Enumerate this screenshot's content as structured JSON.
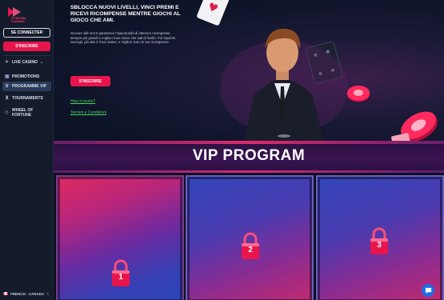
{
  "brand": {
    "logo_text": "STREAM\nCASINO"
  },
  "sidebar": {
    "connect_label": "SE CONNECTER",
    "signup_label": "S'INSCRIRE",
    "items": [
      {
        "label": "LIVE CASINO",
        "icon": "diamond-icon",
        "has_chevron": true
      },
      {
        "label": "PROMOTIONS",
        "icon": "gift-icon"
      },
      {
        "label": "PROGRAMME VIP",
        "icon": "crown-icon",
        "active": true
      },
      {
        "label": "TOURNAMENTS",
        "icon": "trophy-icon"
      },
      {
        "label": "WHEEL OF FORTUNE",
        "icon": "tag-icon"
      }
    ],
    "language": "FRENCH - CANADA"
  },
  "hero": {
    "title": "SBLOCCA NUOVI LIVELLI, VINCI PREMI E RICEVI RICOMPENSE MENTRE GIOCHI AL GIOCO CHE AMI.",
    "description": "Giocare alle slot ti garantisce l'opportunità di ottenere ricompense sempre più grandi e migliori man mano che sali di livello. Più Gpoints raccogli, più alto è il tuo status, e migliori sono le tue ricompense.",
    "cta_label": "S'INSCRIRE",
    "link_how": "How it works?",
    "link_terms": "Termini e Condizioni"
  },
  "vip": {
    "title": "VIP PROGRAM",
    "levels": [
      "1",
      "2",
      "3"
    ]
  },
  "colors": {
    "accent": "#e8154c",
    "link": "#47d65f",
    "sidebar_bg": "#141b2b"
  }
}
